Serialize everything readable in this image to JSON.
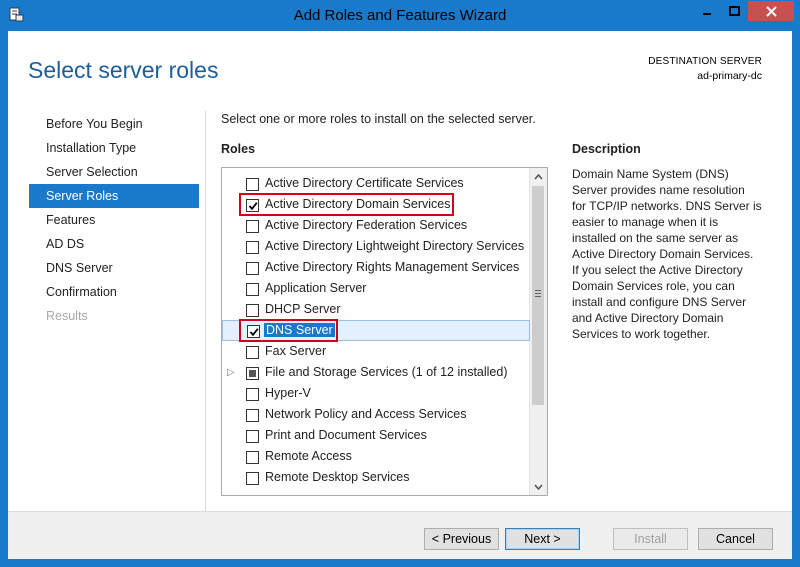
{
  "window": {
    "title": "Add Roles and Features Wizard",
    "controls": {
      "minimize": "—",
      "maximize": "□",
      "close": "✕"
    }
  },
  "header": {
    "page_title": "Select server roles",
    "destination_label": "DESTINATION SERVER",
    "destination_name": "ad-primary-dc"
  },
  "nav": {
    "items": [
      {
        "label": "Before You Begin",
        "state": "normal"
      },
      {
        "label": "Installation Type",
        "state": "normal"
      },
      {
        "label": "Server Selection",
        "state": "normal"
      },
      {
        "label": "Server Roles",
        "state": "active"
      },
      {
        "label": "Features",
        "state": "normal"
      },
      {
        "label": "AD DS",
        "state": "normal"
      },
      {
        "label": "DNS Server",
        "state": "normal"
      },
      {
        "label": "Confirmation",
        "state": "normal"
      },
      {
        "label": "Results",
        "state": "disabled"
      }
    ]
  },
  "main": {
    "intro": "Select one or more roles to install on the selected server.",
    "roles_heading": "Roles",
    "roles": [
      {
        "label": "Active Directory Certificate Services",
        "checked": false
      },
      {
        "label": "Active Directory Domain Services",
        "checked": true
      },
      {
        "label": "Active Directory Federation Services",
        "checked": false
      },
      {
        "label": "Active Directory Lightweight Directory Services",
        "checked": false
      },
      {
        "label": "Active Directory Rights Management Services",
        "checked": false
      },
      {
        "label": "Application Server",
        "checked": false
      },
      {
        "label": "DHCP Server",
        "checked": false
      },
      {
        "label": "DNS Server",
        "checked": true,
        "selected": true
      },
      {
        "label": "Fax Server",
        "checked": false
      },
      {
        "label": "File and Storage Services (1 of 12 installed)",
        "checked": "partial",
        "expandable": true
      },
      {
        "label": "Hyper-V",
        "checked": false
      },
      {
        "label": "Network Policy and Access Services",
        "checked": false
      },
      {
        "label": "Print and Document Services",
        "checked": false
      },
      {
        "label": "Remote Access",
        "checked": false
      },
      {
        "label": "Remote Desktop Services",
        "checked": false
      }
    ],
    "scroll_position": 0.0
  },
  "description": {
    "heading": "Description",
    "text": "Domain Name System (DNS) Server provides name resolution for TCP/IP networks. DNS Server is easier to manage when it is installed on the same server as Active Directory Domain Services. If you select the Active Directory Domain Services role, you can install and configure DNS Server and Active Directory Domain Services to work together."
  },
  "footer": {
    "previous": "< Previous",
    "next": "Next >",
    "install": "Install",
    "cancel": "Cancel"
  },
  "colors": {
    "accent": "#1979ca",
    "highlight_box": "#d0021b",
    "close_button": "#c75050"
  }
}
